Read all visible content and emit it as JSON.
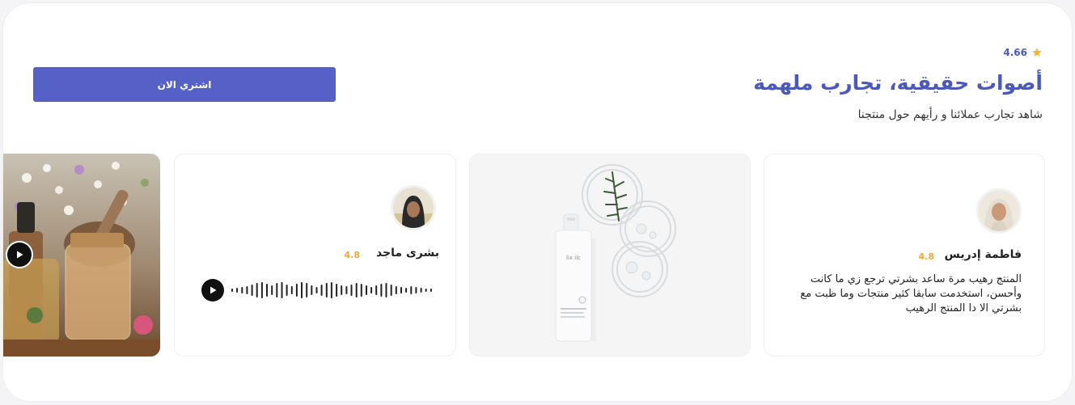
{
  "header": {
    "rating_value": "4.66",
    "title": "أصوات حقيقية، تجارب ملهمة",
    "subtitle": "شاهد تجارب عملائنا و رأيهم حول منتجنا",
    "buy_label": "اشتري الان"
  },
  "reviews": [
    {
      "name": "فاطمة إدريس",
      "score": "4.8",
      "text": "المنتج رهيب مرة ساعد بشرتي ترجع زي ما كانت وأحسن، استخدمت سابقا كثير منتجات وما ظبت مع بشرتي الا دا المنتج الرهيب"
    },
    {
      "name": "بشرى ماجد",
      "score": "4.8",
      "type": "audio"
    }
  ],
  "colors": {
    "accent": "#4b5ab8",
    "button": "#5561c7",
    "score": "#f0a83a",
    "star": "#f5b53d"
  },
  "icons": {
    "rating": "star-icon",
    "play": "play-icon",
    "audio": "waveform-icon"
  }
}
